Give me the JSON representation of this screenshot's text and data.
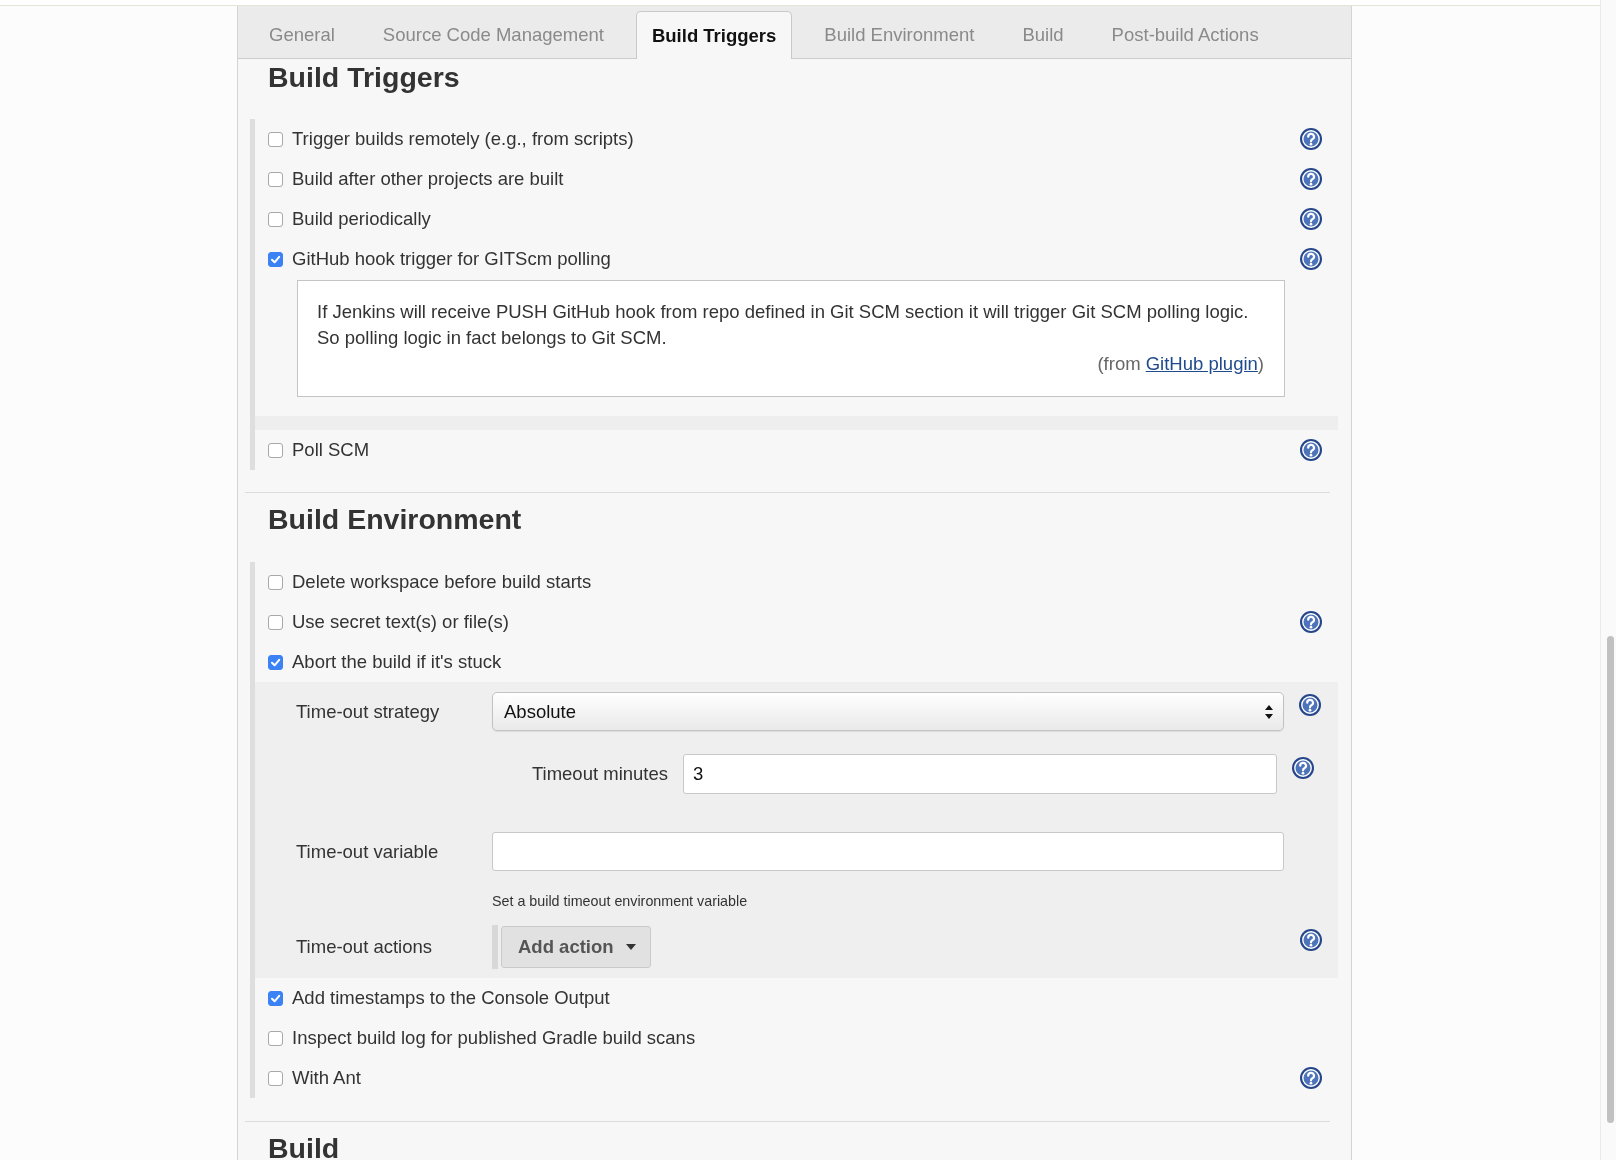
{
  "tabs": [
    {
      "label": "General",
      "selected": false
    },
    {
      "label": "Source Code Management",
      "selected": false
    },
    {
      "label": "Build Triggers",
      "selected": true
    },
    {
      "label": "Build Environment",
      "selected": false
    },
    {
      "label": "Build",
      "selected": false
    },
    {
      "label": "Post-build Actions",
      "selected": false
    }
  ],
  "sections": [
    {
      "title": "Build Triggers",
      "options": [
        {
          "label": "Trigger builds remotely (e.g., from scripts)",
          "checked": false,
          "help": true
        },
        {
          "label": "Build after other projects are built",
          "checked": false,
          "help": true
        },
        {
          "label": "Build periodically",
          "checked": false,
          "help": true
        },
        {
          "label": "GitHub hook trigger for GITScm polling",
          "checked": true,
          "help": true,
          "description": {
            "lines": [
              "If Jenkins will receive PUSH GitHub hook from repo defined in Git SCM section it will trigger Git SCM polling logic.",
              "So polling logic in fact belongs to Git SCM."
            ],
            "attribution": {
              "prefix": "(from",
              "link": "GitHub plugin",
              "suffix": ")"
            }
          }
        },
        {
          "label": "Poll SCM",
          "checked": false,
          "help": true
        }
      ]
    },
    {
      "title": "Build Environment",
      "options": [
        {
          "label": "Delete workspace before build starts",
          "checked": false,
          "help": false
        },
        {
          "label": "Use secret text(s) or file(s)",
          "checked": false,
          "help": true
        },
        {
          "label": "Abort the build if it's stuck",
          "checked": true,
          "help": false,
          "settings": [
            {
              "kind": "select",
              "label": "Time-out strategy",
              "value": "Absolute",
              "help": true
            },
            {
              "kind": "number",
              "label": "Timeout minutes",
              "value": "3",
              "help": true
            },
            {
              "kind": "text",
              "label": "Time-out variable",
              "hint": "Set a build timeout environment variable",
              "help": false
            },
            {
              "kind": "actions",
              "label": "Time-out actions",
              "button": "Add action",
              "help": true
            }
          ]
        },
        {
          "label": "Add timestamps to the Console Output",
          "checked": true,
          "help": false
        },
        {
          "label": "Inspect build log for published Gradle build scans",
          "checked": false,
          "help": false
        },
        {
          "label": "With Ant",
          "checked": false,
          "help": true
        }
      ]
    },
    {
      "title": "Build"
    }
  ]
}
